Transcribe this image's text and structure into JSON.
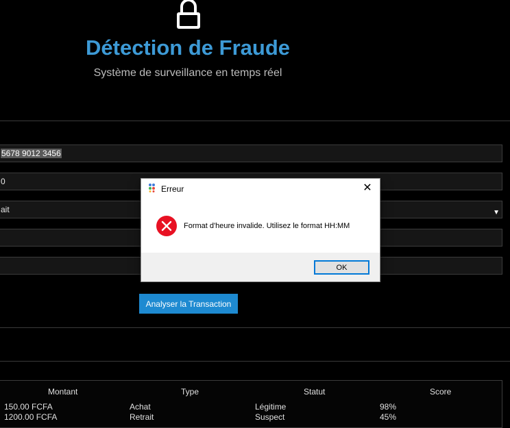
{
  "header": {
    "title": "Détection de Fraude",
    "subtitle": "Système de surveillance en temps réel"
  },
  "form": {
    "card_number_value": "5678 9012 3456",
    "amount_value": "0",
    "type_value": "ait",
    "time_value": "",
    "location_value": "",
    "analyze_label": "Analyser la Transaction"
  },
  "table": {
    "headers": [
      "Montant",
      "Type",
      "Statut",
      "Score"
    ],
    "rows": [
      [
        "150.00 FCFA",
        "Achat",
        "Légitime",
        "98%"
      ],
      [
        "1200.00 FCFA",
        "Retrait",
        "Suspect",
        "45%"
      ]
    ]
  },
  "dialog": {
    "title": "Erreur",
    "message": "Format d'heure invalide. Utilisez le format HH:MM",
    "ok_label": "OK",
    "close_glyph": "✕"
  },
  "colors": {
    "accent": "#3d9ad6",
    "button": "#1e8ad1",
    "error": "#e81123",
    "ok_border": "#0078d7"
  }
}
